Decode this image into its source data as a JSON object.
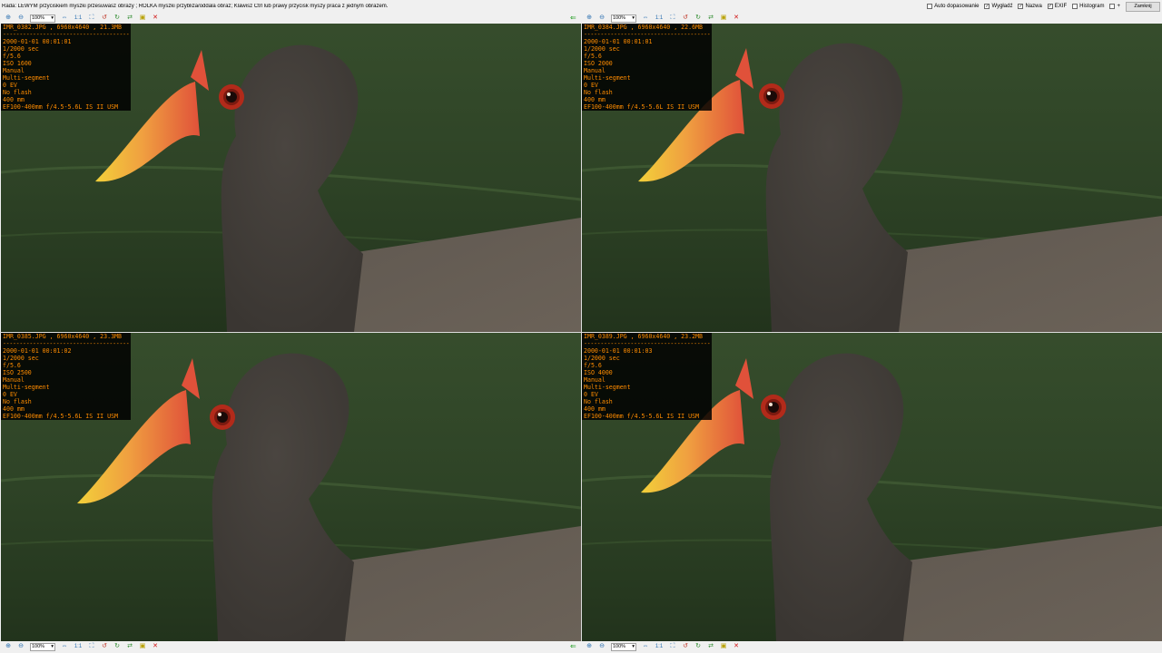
{
  "top_bar": {
    "hint": "Rada: LEWYM przyciskiem myszki przesuwasz obrazy ; ROLKA myszki przybliża/oddala obraz; Klawisz Ctrl lub prawy przycisk myszy praca z jednym obrazem.",
    "options": [
      {
        "label": "Auto dopasowanie",
        "checked": false
      },
      {
        "label": "Wygładź",
        "checked": true
      },
      {
        "label": "Nazwa",
        "checked": true
      },
      {
        "label": "EXIF",
        "checked": true
      },
      {
        "label": "Histogram",
        "checked": false
      },
      {
        "label": "+",
        "checked": false
      }
    ],
    "close_label": "Zamknij"
  },
  "toolbar": {
    "zoom_value": "100%",
    "actual_size": "1:1"
  },
  "panels": [
    {
      "title": "IMR_0382.JPG , 6960x4640 , 21.3MB",
      "datetime": "2000-01-01 00:01:01",
      "shutter": "1/2000 sec",
      "aperture": "f/5.6",
      "iso": "ISO 1600",
      "mode": "Manual",
      "metering": "Multi-segment",
      "ev": "0 EV",
      "flash": "No flash",
      "focal": "400 mm",
      "lens": "EF100-400mm f/4.5-5.6L IS II USM"
    },
    {
      "title": "IMR_0384.JPG , 6960x4640 , 22.6MB",
      "datetime": "2000-01-01 00:01:01",
      "shutter": "1/2000 sec",
      "aperture": "f/5.6",
      "iso": "ISO 2000",
      "mode": "Manual",
      "metering": "Multi-segment",
      "ev": "0 EV",
      "flash": "No flash",
      "focal": "400 mm",
      "lens": "EF100-400mm f/4.5-5.6L IS II USM"
    },
    {
      "title": "IMR_0385.JPG , 6960x4640 , 23.3MB",
      "datetime": "2000-01-01 00:01:02",
      "shutter": "1/2000 sec",
      "aperture": "f/5.6",
      "iso": "ISO 2500",
      "mode": "Manual",
      "metering": "Multi-segment",
      "ev": "0 EV",
      "flash": "No flash",
      "focal": "400 mm",
      "lens": "EF100-400mm f/4.5-5.6L IS II USM"
    },
    {
      "title": "IMR_0389.JPG , 6960x4640 , 23.2MB",
      "datetime": "2000-01-01 00:01:03",
      "shutter": "1/2000 sec",
      "aperture": "f/5.6",
      "iso": "ISO 4000",
      "mode": "Manual",
      "metering": "Multi-segment",
      "ev": "0 EV",
      "flash": "No flash",
      "focal": "400 mm",
      "lens": "EF100-400mm f/4.5-5.6L IS II USM"
    }
  ],
  "colors": {
    "exif_text": "#ff8c00",
    "water": "#2e4326",
    "bird_head": "#3a3632",
    "bird_body": "#6b6258",
    "beak_red": "#e0513a",
    "beak_yellow": "#f2d03a"
  }
}
